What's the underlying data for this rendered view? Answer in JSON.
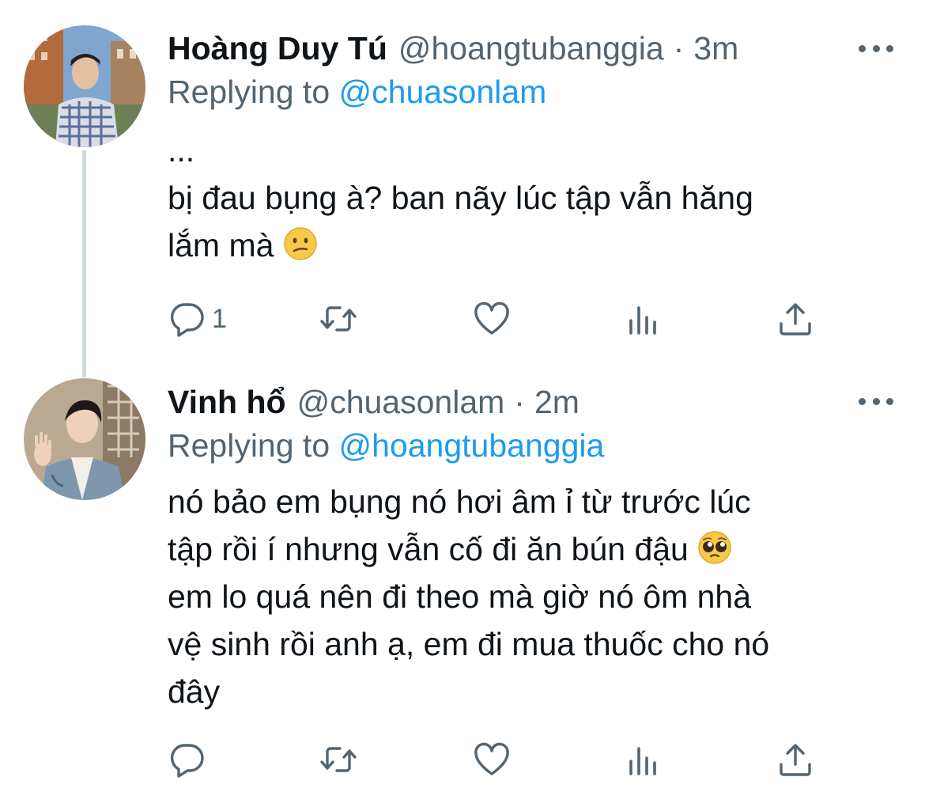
{
  "tweets": [
    {
      "display_name": "Hoàng Duy Tú",
      "handle": "@hoangtubanggia",
      "dot": "·",
      "time": "3m",
      "replying_prefix": "Replying to",
      "replying_to": "@chuasonlam",
      "text_lines": [
        "...",
        "bị đau bụng à? ban nãy lúc tập vẫn hăng",
        "lắm mà"
      ],
      "emoji": "confused-face",
      "reply_count": "1",
      "more_icon": "more-horizontal-icon"
    },
    {
      "display_name": "Vinh hổ",
      "handle": "@chuasonlam",
      "dot": "·",
      "time": "2m",
      "replying_prefix": "Replying to",
      "replying_to": "@hoangtubanggia",
      "text_lines": [
        "nó bảo em bụng nó hơi âm ỉ từ trước lúc",
        "tập rồi í nhưng vẫn cố đi ăn bún đậu",
        "em lo quá nên đi theo mà giờ nó ôm nhà",
        "vệ sinh rồi anh ạ, em đi mua thuốc cho nó",
        "đây"
      ],
      "emoji": "pleading-face",
      "reply_count": "",
      "more_icon": "more-horizontal-icon"
    }
  ],
  "colors": {
    "text_primary": "#0f1419",
    "text_secondary": "#536471",
    "mention_blue": "#1d9bf0",
    "thread_line": "#cfd9de"
  },
  "action_icons": [
    "reply-icon",
    "retweet-icon",
    "like-icon",
    "analytics-icon",
    "share-icon"
  ]
}
